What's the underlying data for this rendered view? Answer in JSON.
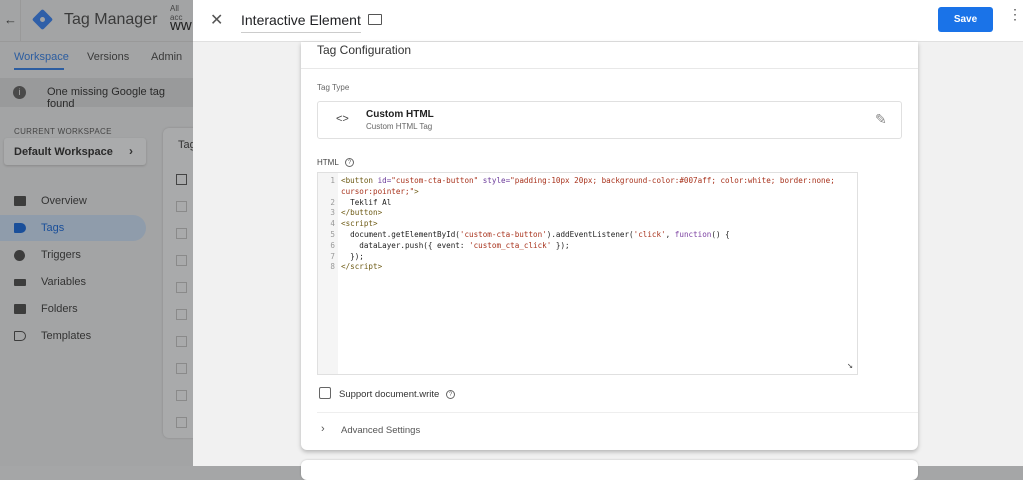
{
  "app": {
    "title": "Tag Manager",
    "account_label": "All acc",
    "container": "ww"
  },
  "tabs": [
    {
      "label": "Workspace"
    },
    {
      "label": "Versions"
    },
    {
      "label": "Admin"
    }
  ],
  "notice": "One missing Google tag found",
  "workspace": {
    "heading": "CURRENT WORKSPACE",
    "name": "Default Workspace"
  },
  "nav": [
    {
      "label": "Overview"
    },
    {
      "label": "Tags"
    },
    {
      "label": "Triggers"
    },
    {
      "label": "Variables"
    },
    {
      "label": "Folders"
    },
    {
      "label": "Templates"
    }
  ],
  "bg_card_title": "Tag",
  "panel": {
    "title": "Interactive Element",
    "save_label": "Save"
  },
  "config": {
    "heading": "Tag Configuration",
    "tag_type_label": "Tag Type",
    "tag_type_name": "Custom HTML",
    "tag_type_sub": "Custom HTML Tag",
    "html_label": "HTML",
    "code": [
      {
        "n": "1",
        "segs": [
          [
            "<button ",
            "tag"
          ],
          [
            "id=",
            "attr"
          ],
          [
            "\"custom-cta-button\" ",
            "str"
          ],
          [
            "style=",
            "attr"
          ],
          [
            "\"padding:10px 20px; background-color:#007aff; color:white; border:none;",
            "str"
          ]
        ]
      },
      {
        "n": "",
        "segs": [
          [
            "cursor:pointer;\"",
            "str"
          ],
          [
            ">",
            "tag"
          ]
        ]
      },
      {
        "n": "2",
        "segs": [
          [
            "  Teklif Al",
            "txt"
          ]
        ]
      },
      {
        "n": "3",
        "segs": [
          [
            "</button>",
            "tag"
          ]
        ]
      },
      {
        "n": "4",
        "segs": [
          [
            "<script>",
            "tag"
          ]
        ]
      },
      {
        "n": "5",
        "segs": [
          [
            "  document.getElementById(",
            "txt"
          ],
          [
            "'custom-cta-button'",
            "str"
          ],
          [
            ").addEventListener(",
            "txt"
          ],
          [
            "'click'",
            "str"
          ],
          [
            ", ",
            "txt"
          ],
          [
            "function",
            "kw"
          ],
          [
            "() {",
            "txt"
          ]
        ]
      },
      {
        "n": "6",
        "segs": [
          [
            "    dataLayer.push({ event: ",
            "txt"
          ],
          [
            "'custom_cta_click'",
            "str"
          ],
          [
            " });",
            "txt"
          ]
        ]
      },
      {
        "n": "7",
        "segs": [
          [
            "  });",
            "txt"
          ]
        ]
      },
      {
        "n": "8",
        "segs": [
          [
            "</script>",
            "tag"
          ]
        ]
      }
    ],
    "support_docwrite": "Support document.write",
    "support_checked": false,
    "advanced": "Advanced Settings"
  },
  "colors": {
    "accent": "#1a73e8"
  }
}
